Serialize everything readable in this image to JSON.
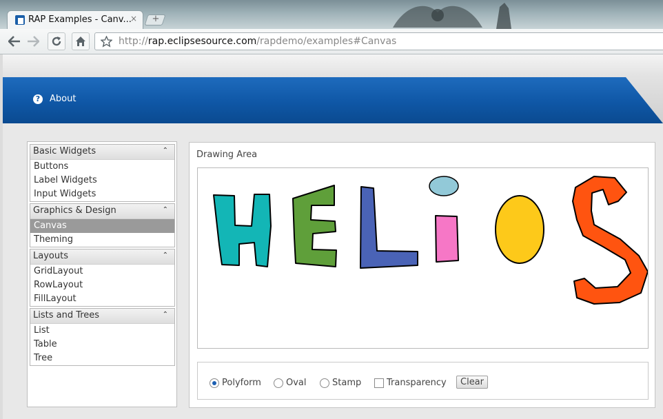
{
  "browser": {
    "tab_title": "RAP Examples - Canv...",
    "tab_close": "×",
    "newtab": "+",
    "url_prefix": "http://",
    "url_host": "rap.eclipsesource.com",
    "url_path": "/rapdemo/examples#Canvas"
  },
  "header": {
    "about_label": "About",
    "about_icon": "?"
  },
  "nav": {
    "groups": [
      {
        "title": "Basic Widgets",
        "items": [
          "Buttons",
          "Label Widgets",
          "Input Widgets"
        ]
      },
      {
        "title": "Graphics & Design",
        "items": [
          "Canvas",
          "Theming"
        ]
      },
      {
        "title": "Layouts",
        "items": [
          "GridLayout",
          "RowLayout",
          "FillLayout"
        ]
      },
      {
        "title": "Lists and Trees",
        "items": [
          "List",
          "Table",
          "Tree"
        ]
      }
    ],
    "selected_item": "Canvas",
    "collapse_glyph": "⌃"
  },
  "main": {
    "drawing_area_label": "Drawing Area",
    "shape_colors": {
      "h": "#13b6b6",
      "e": "#5f9f3a",
      "l": "#4a63b6",
      "i_dot": "#92c9d8",
      "i_stem": "#f677c6",
      "o": "#fdc91a",
      "s": "#ff5410"
    },
    "options": {
      "polyform": "Polyform",
      "oval": "Oval",
      "stamp": "Stamp",
      "transparency": "Transparency",
      "selected": "polyform",
      "transparency_checked": false
    },
    "clear_label": "Clear"
  }
}
